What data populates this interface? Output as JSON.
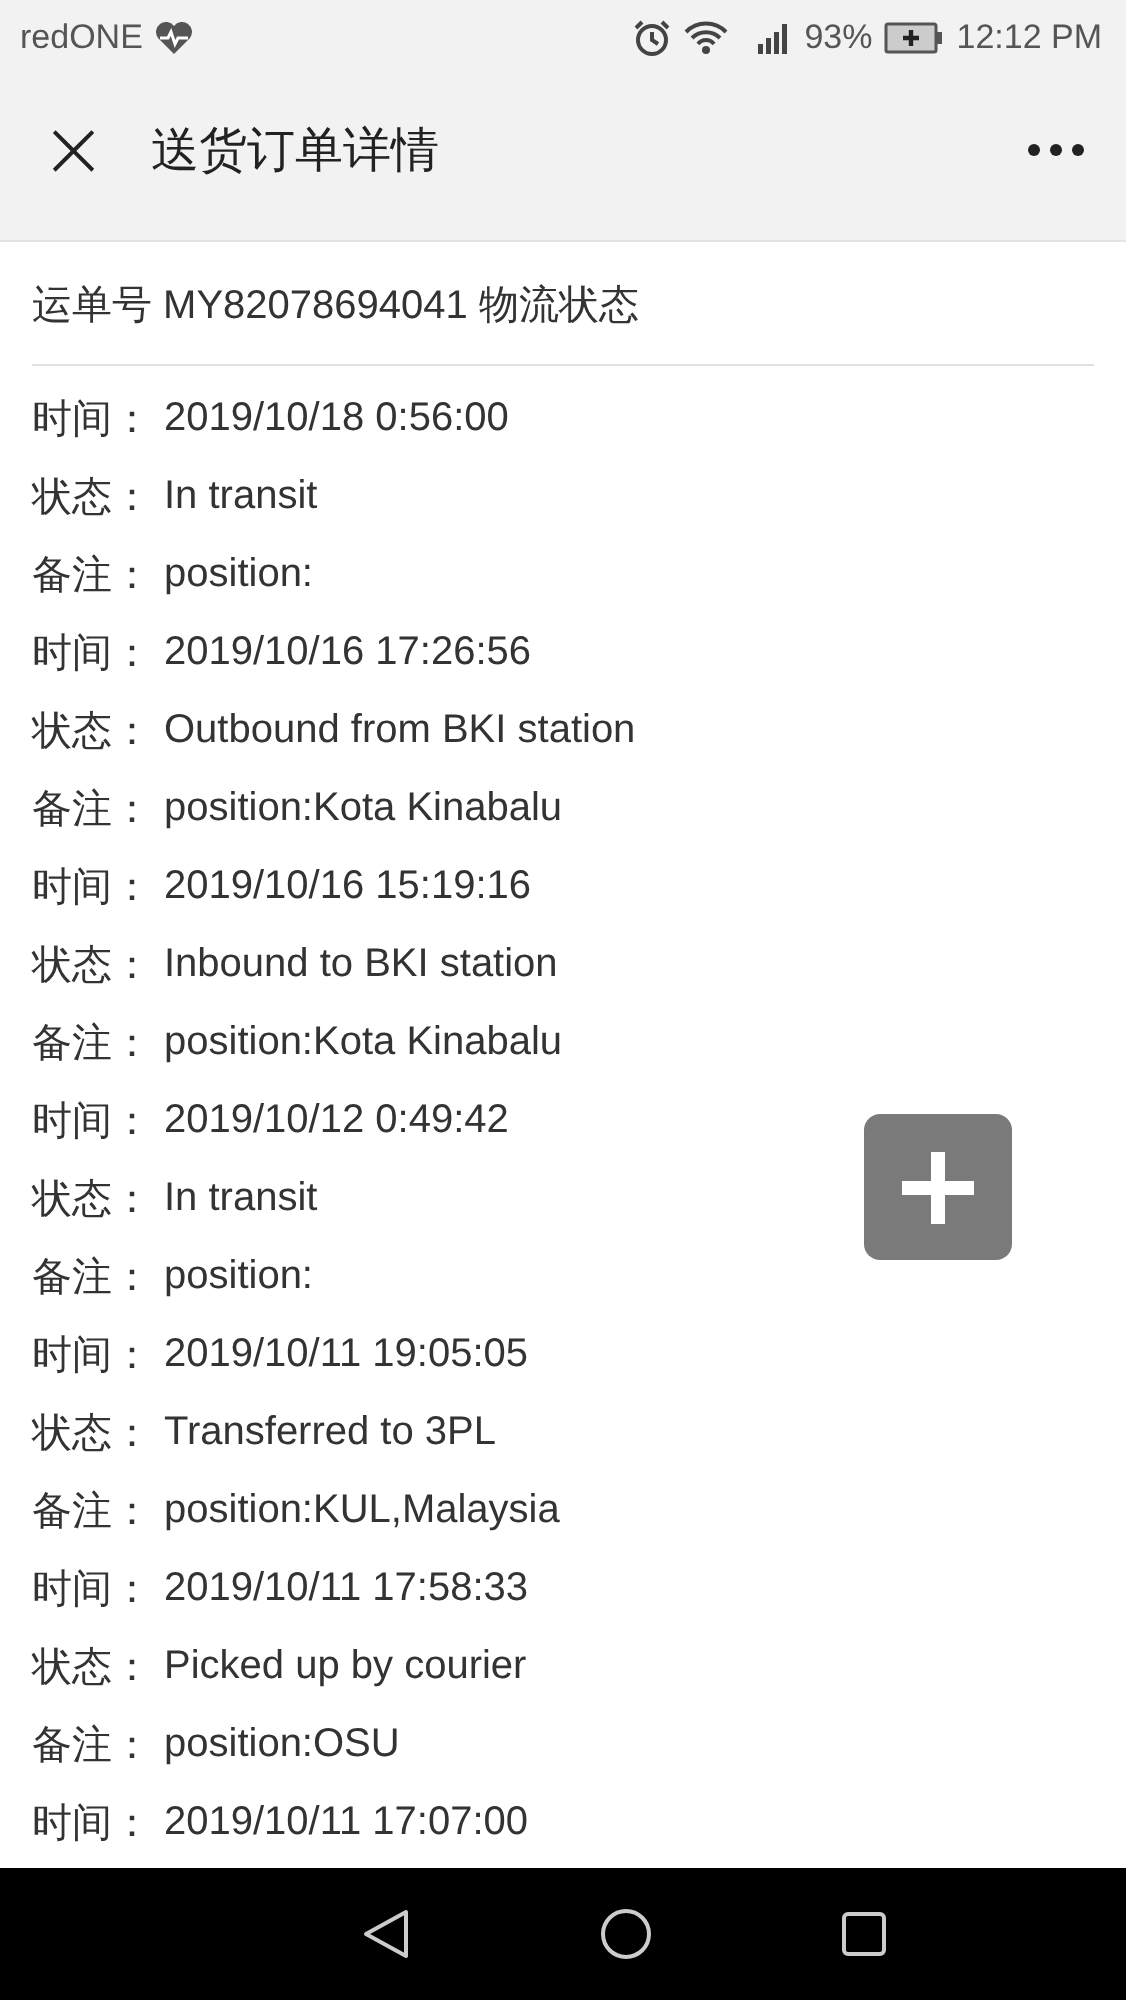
{
  "status_bar": {
    "carrier": "redONE",
    "battery": "93%",
    "time": "12:12 PM"
  },
  "header": {
    "close": "×",
    "title": "送货订单详情"
  },
  "tracking": {
    "title": "运单号 MY82078694041 物流状态",
    "events": [
      {
        "time_label": "时间：",
        "time": "2019/10/18 0:56:00",
        "status_label": "状态：",
        "status": "In transit",
        "note_label": "备注：",
        "note": "position:"
      },
      {
        "time_label": "时间：",
        "time": "2019/10/16 17:26:56",
        "status_label": "状态：",
        "status": "Outbound from BKI station",
        "note_label": "备注：",
        "note": "position:Kota Kinabalu"
      },
      {
        "time_label": "时间：",
        "time": "2019/10/16 15:19:16",
        "status_label": "状态：",
        "status": "Inbound to BKI station",
        "note_label": "备注：",
        "note": "position:Kota Kinabalu"
      },
      {
        "time_label": "时间：",
        "time": "2019/10/12 0:49:42",
        "status_label": "状态：",
        "status": "In transit",
        "note_label": "备注：",
        "note": "position:"
      },
      {
        "time_label": "时间：",
        "time": "2019/10/11 19:05:05",
        "status_label": "状态：",
        "status": "Transferred to 3PL",
        "note_label": "备注：",
        "note": "position:KUL,Malaysia"
      },
      {
        "time_label": "时间：",
        "time": "2019/10/11 17:58:33",
        "status_label": "状态：",
        "status": "Picked up by courier",
        "note_label": "备注：",
        "note": "position:OSU"
      },
      {
        "time_label": "时间：",
        "time": "2019/10/11 17:07:00"
      }
    ]
  }
}
